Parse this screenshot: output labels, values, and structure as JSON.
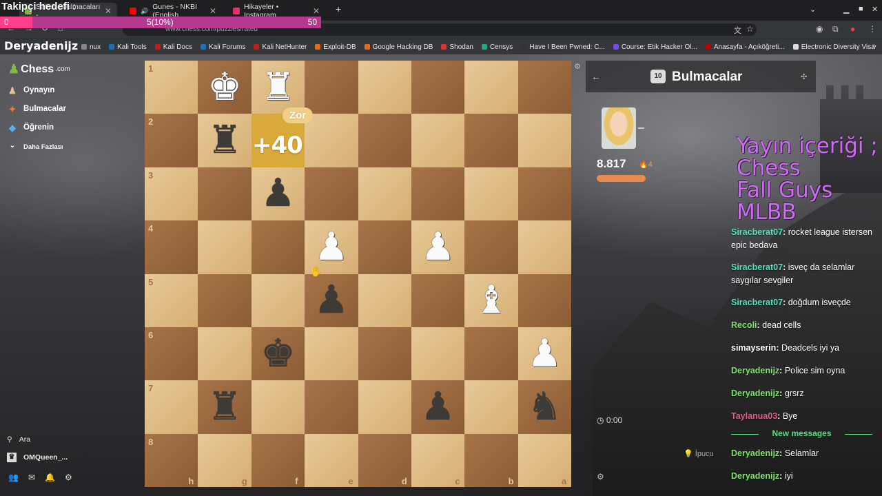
{
  "overlay": {
    "follower_goal_title": "Takipçi hedefi :",
    "goal_start": "0",
    "goal_progress": "5(10%)",
    "goal_end": "50",
    "goal_fraction": 0.1,
    "channel_name": "Deryadenijz"
  },
  "browser": {
    "tabs": [
      {
        "label": "Satranç bulmacaları -",
        "color": "#81b64c"
      },
      {
        "label": "Gunes - NKBI (English",
        "color": "#ff0000"
      },
      {
        "label": "Hikayeler • Instagram",
        "color": "#e1306c"
      }
    ],
    "new_tab": "+",
    "url": "www.chess.com/puzzles/rated",
    "bookmarks": [
      {
        "label": "nux",
        "color": "#888"
      },
      {
        "label": "Kali Tools",
        "color": "#1d6fb8"
      },
      {
        "label": "Kali Docs",
        "color": "#c21c1c"
      },
      {
        "label": "Kali Forums",
        "color": "#1d6fb8"
      },
      {
        "label": "Kali NetHunter",
        "color": "#c21c1c"
      },
      {
        "label": "Exploit-DB",
        "color": "#e8681f"
      },
      {
        "label": "Google Hacking DB",
        "color": "#e8681f"
      },
      {
        "label": "Shodan",
        "color": "#d33"
      },
      {
        "label": "Censys",
        "color": "#2a7"
      },
      {
        "label": "Have I Been Pwned: C...",
        "color": "#333"
      },
      {
        "label": "Course: Etik Hacker Ol...",
        "color": "#7a4ae0"
      },
      {
        "label": "Anasayfa - Açıköğreti...",
        "color": "#b00"
      },
      {
        "label": "Electronic Diversity Visa",
        "color": "#ddd"
      }
    ]
  },
  "sidebar": {
    "brand": "Chess",
    "brand_suffix": ".com",
    "items": [
      {
        "label": "Oynayın",
        "icon": "play-pawn-icon"
      },
      {
        "label": "Bulmacalar",
        "icon": "puzzle-icon"
      },
      {
        "label": "Öğrenin",
        "icon": "graduation-cap-icon"
      },
      {
        "label": "Daha Fazlası",
        "icon": "chevron-down-icon"
      }
    ],
    "search": "Ara",
    "user": "OMQueen_..."
  },
  "board": {
    "ranks": [
      "1",
      "2",
      "3",
      "4",
      "5",
      "6",
      "7",
      "8"
    ],
    "files": [
      "h",
      "g",
      "f",
      "e",
      "d",
      "c",
      "b",
      "a"
    ],
    "highlight_square": "f2",
    "score_badge": "+40",
    "difficulty": "Zor",
    "pieces": [
      {
        "glyph": "♚",
        "color": "w",
        "col": 1,
        "row": 0
      },
      {
        "glyph": "♜",
        "color": "w",
        "col": 2,
        "row": 0
      },
      {
        "glyph": "♜",
        "color": "b",
        "col": 1,
        "row": 1
      },
      {
        "glyph": "♟",
        "color": "b",
        "col": 2,
        "row": 2
      },
      {
        "glyph": "♟",
        "color": "w",
        "col": 3,
        "row": 3
      },
      {
        "glyph": "♟",
        "color": "w",
        "col": 5,
        "row": 3
      },
      {
        "glyph": "♟",
        "color": "b",
        "col": 3,
        "row": 4
      },
      {
        "glyph": "♝",
        "color": "w",
        "col": 6,
        "row": 4
      },
      {
        "glyph": "♚",
        "color": "b",
        "col": 2,
        "row": 5
      },
      {
        "glyph": "♟",
        "color": "w",
        "col": 7,
        "row": 5
      },
      {
        "glyph": "♜",
        "color": "b",
        "col": 1,
        "row": 6
      },
      {
        "glyph": "♟",
        "color": "b",
        "col": 5,
        "row": 6
      },
      {
        "glyph": "♞",
        "color": "b",
        "col": 7,
        "row": 6
      }
    ]
  },
  "panel": {
    "title": "Bulmacalar",
    "title_badge": "10",
    "rating": "8.817",
    "streak": "4",
    "timer": "0:00",
    "hint": "İpucu"
  },
  "stream_content": [
    "Yayın içeriği ;",
    "Chess",
    "Fall Guys",
    "MLBB"
  ],
  "chat": [
    {
      "user": "Siracberat07",
      "text": "rocket league istersen epic bedava",
      "color": "#55e0c0"
    },
    {
      "user": "Siracberat07",
      "text": "isveç da selamlar saygılar sevgiler",
      "color": "#55e0c0"
    },
    {
      "user": "Siracberat07",
      "text": "doğdum isveçde",
      "color": "#55e0c0"
    },
    {
      "user": "Recoli",
      "text": "dead cells",
      "color": "#7de36b"
    },
    {
      "user": "simayserin",
      "text": "Deadcels iyi ya",
      "color": "#ffffff"
    },
    {
      "user": "Deryadenijz",
      "text": "Police sim oyna",
      "color": "#7de36b"
    },
    {
      "user": "Deryadenijz",
      "text": "grsrz",
      "color": "#7de36b"
    },
    {
      "user": "Taylanua03",
      "text": "Bye",
      "color": "#e35b8a"
    },
    {
      "user": "Deryadenijz",
      "text": "Selamlar",
      "color": "#7de36b"
    },
    {
      "user": "Deryadenijz",
      "text": "iyi",
      "color": "#7de36b"
    }
  ],
  "chat_divider": "New messages"
}
